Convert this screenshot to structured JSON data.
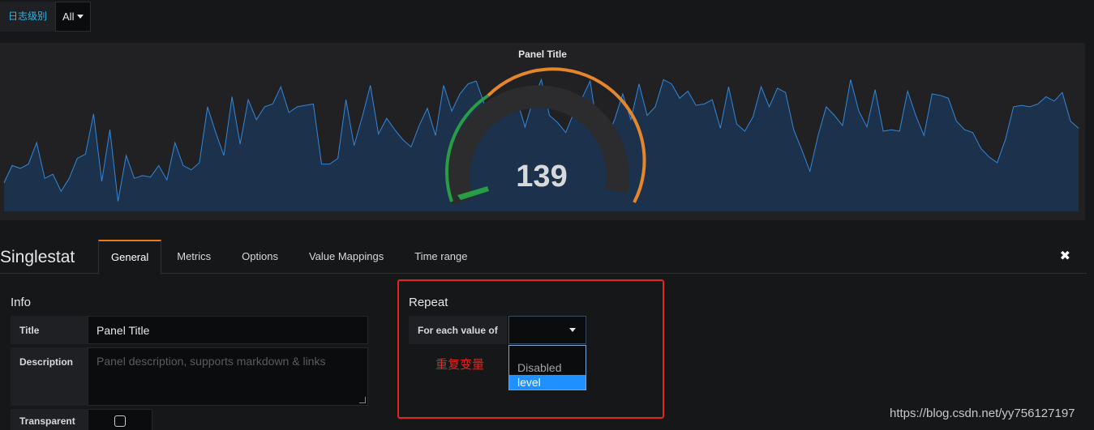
{
  "variable": {
    "label": "日志级别",
    "value": "All"
  },
  "panel": {
    "title": "Panel Title",
    "value": "139"
  },
  "sparkline": [
    60,
    72,
    70,
    73,
    88,
    63,
    66,
    54,
    63,
    77,
    80,
    108,
    61,
    97,
    47,
    79,
    63,
    65,
    64,
    72,
    62,
    88,
    72,
    69,
    74,
    113,
    95,
    79,
    120,
    87,
    118,
    104,
    113,
    115,
    127,
    109,
    113,
    114,
    115,
    73,
    73,
    77,
    118,
    86,
    106,
    128,
    94,
    105,
    97,
    90,
    85,
    100,
    112,
    93,
    128,
    110,
    122,
    129,
    131,
    115,
    104,
    108,
    121,
    118,
    99,
    118,
    132,
    107,
    102,
    95,
    109,
    119,
    131,
    94,
    91,
    104,
    122,
    104,
    129,
    107,
    113,
    132,
    129,
    119,
    124,
    114,
    115,
    118,
    98,
    127,
    101,
    96,
    106,
    127,
    113,
    126,
    123,
    97,
    83,
    68,
    93,
    113,
    107,
    100,
    132,
    110,
    99,
    125,
    96,
    97,
    96,
    124,
    107,
    93,
    122,
    121,
    119,
    103,
    97,
    95,
    84,
    78,
    74,
    90,
    113,
    114,
    113,
    115,
    120,
    117,
    123,
    103,
    98
  ],
  "editor": {
    "title": "Singlestat",
    "tabs": [
      "General",
      "Metrics",
      "Options",
      "Value Mappings",
      "Time range"
    ],
    "active_tab": "General",
    "close_icon": "close-icon"
  },
  "info": {
    "heading": "Info",
    "title_label": "Title",
    "title_value": "Panel Title",
    "description_label": "Description",
    "description_placeholder": "Panel description, supports markdown & links",
    "transparent_label": "Transparent"
  },
  "repeat": {
    "heading": "Repeat",
    "for_each_label": "For each value of",
    "selected": "",
    "options": [
      "Disabled",
      "level"
    ],
    "highlighted": "level",
    "note": "重复变量"
  },
  "watermark": "https://blog.csdn.net/yy756127197",
  "colors": {
    "accent": "#eb7b18",
    "gauge_green": "#299c46",
    "gauge_orange": "#e6862b",
    "highlight": "#e0261f",
    "spark_line": "#3387d8"
  }
}
